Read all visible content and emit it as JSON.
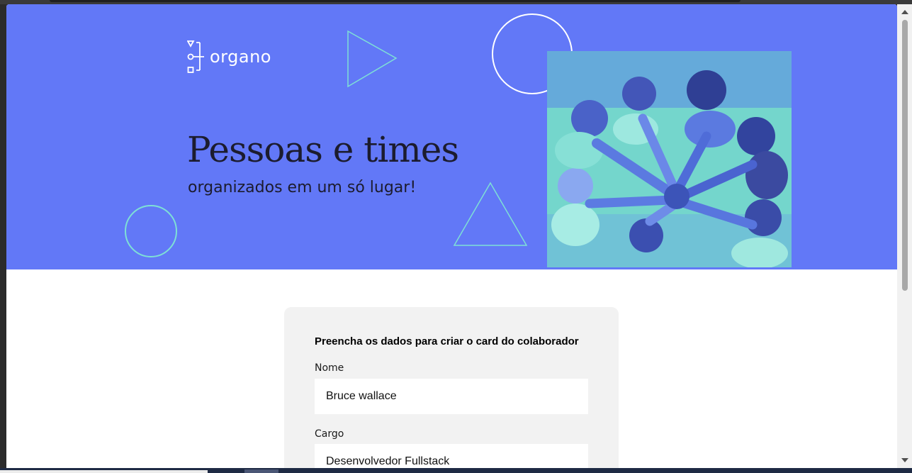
{
  "brand": {
    "name": "organo"
  },
  "hero": {
    "title": "Pessoas e times",
    "subtitle": "organizados em um só lugar!",
    "image": "team-hands-together-photo"
  },
  "colors": {
    "banner": "#6278f7",
    "accent_mint": "#7ee0d6",
    "card_bg": "#f2f2f2"
  },
  "form": {
    "title": "Preencha os dados para criar o card do colaborador",
    "fields": [
      {
        "label": "Nome",
        "value": "Bruce wallace"
      },
      {
        "label": "Cargo",
        "value": "Desenvolvedor Fullstack"
      }
    ]
  }
}
